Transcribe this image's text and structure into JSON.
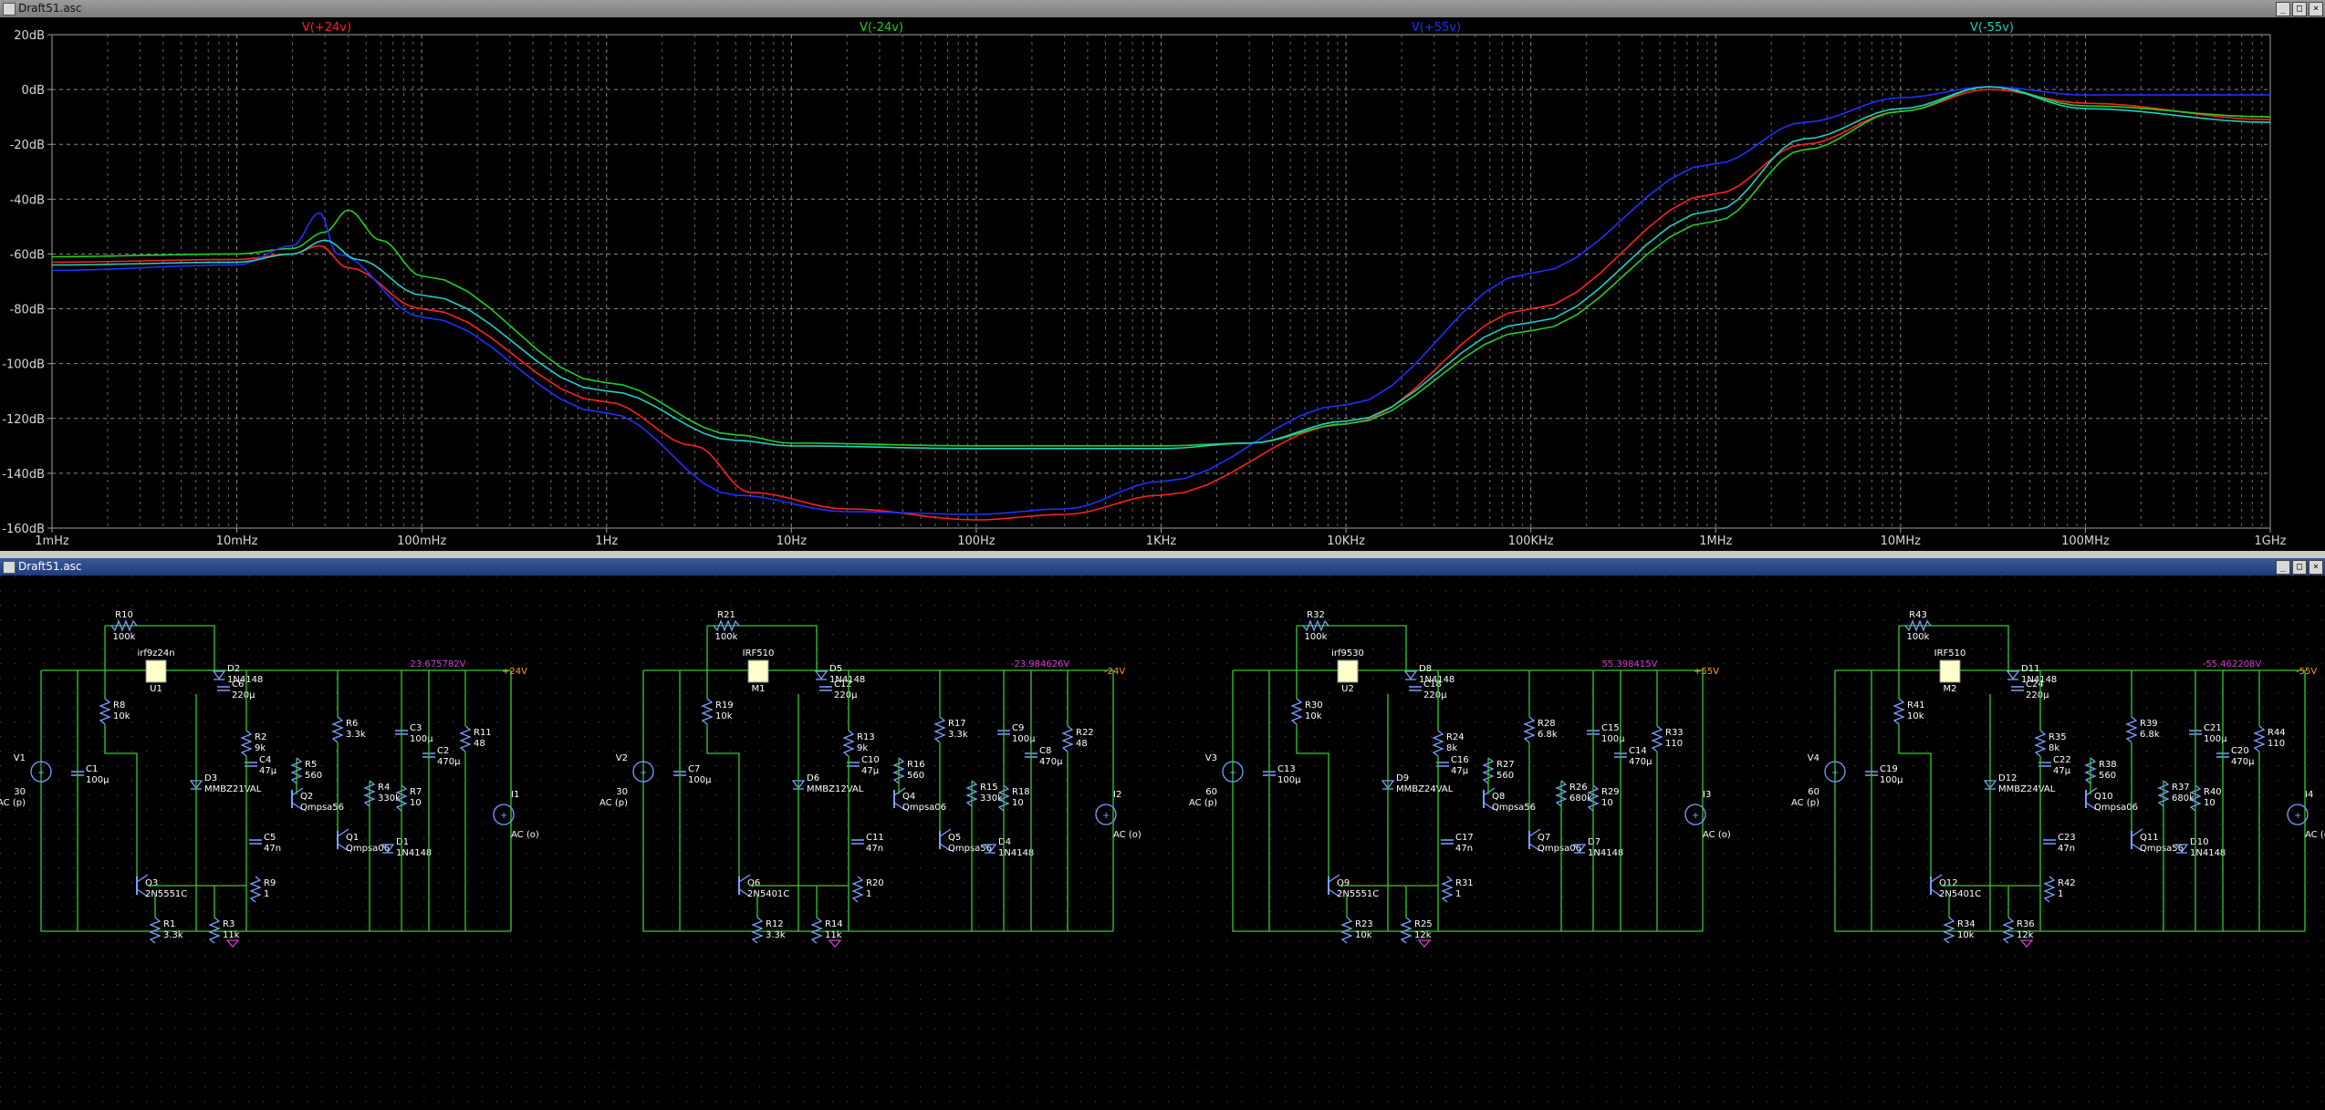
{
  "plot_window": {
    "title": "Draft51.asc",
    "buttons": [
      "_",
      "□",
      "×"
    ]
  },
  "schematic_window": {
    "title": "Draft51.asc",
    "buttons": [
      "_",
      "□",
      "×"
    ]
  },
  "chart_data": {
    "type": "line",
    "title": "",
    "xlabel": "",
    "ylabel": "",
    "x_scale": "log",
    "xlim_hz": [
      0.001,
      1000000000
    ],
    "ylim_db": [
      -160,
      20
    ],
    "grid": true,
    "x_tick_labels": [
      "1mHz",
      "10mHz",
      "100mHz",
      "1Hz",
      "10Hz",
      "100Hz",
      "1KHz",
      "10KHz",
      "100KHz",
      "1MHz",
      "10MHz",
      "100MHz",
      "1GHz"
    ],
    "y_tick_labels": [
      "20dB",
      "0dB",
      "-20dB",
      "-40dB",
      "-60dB",
      "-80dB",
      "-100dB",
      "-120dB",
      "-140dB",
      "-160dB"
    ],
    "y_tick_values": [
      20,
      0,
      -20,
      -40,
      -60,
      -80,
      -100,
      -120,
      -140,
      -160
    ],
    "series": [
      {
        "name": "V(+24v)",
        "color": "#ff2020",
        "points": [
          [
            0.001,
            -63
          ],
          [
            0.01,
            -62
          ],
          [
            0.02,
            -60
          ],
          [
            0.028,
            -57
          ],
          [
            0.04,
            -65
          ],
          [
            0.1,
            -80
          ],
          [
            1,
            -114
          ],
          [
            3,
            -130
          ],
          [
            6,
            -147
          ],
          [
            20,
            -153
          ],
          [
            100,
            -157
          ],
          [
            300,
            -155
          ],
          [
            1000,
            -148
          ],
          [
            10000,
            -122
          ],
          [
            100000,
            -80
          ],
          [
            1000000,
            -38
          ],
          [
            3000000,
            -20
          ],
          [
            10000000,
            -8
          ],
          [
            30000000,
            0
          ],
          [
            100000000,
            -5
          ],
          [
            1000000000,
            -11
          ]
        ]
      },
      {
        "name": "V(-24v)",
        "color": "#20d020",
        "points": [
          [
            0.001,
            -61
          ],
          [
            0.01,
            -60
          ],
          [
            0.02,
            -58
          ],
          [
            0.03,
            -52
          ],
          [
            0.04,
            -44
          ],
          [
            0.06,
            -55
          ],
          [
            0.1,
            -68
          ],
          [
            1,
            -107
          ],
          [
            5,
            -126
          ],
          [
            10,
            -129
          ],
          [
            100,
            -130
          ],
          [
            1000,
            -130
          ],
          [
            3000,
            -129
          ],
          [
            10000,
            -122
          ],
          [
            100000,
            -88
          ],
          [
            1000000,
            -48
          ],
          [
            3000000,
            -22
          ],
          [
            10000000,
            -8
          ],
          [
            30000000,
            1
          ],
          [
            100000000,
            -6
          ],
          [
            1000000000,
            -10
          ]
        ]
      },
      {
        "name": "V(+55v)",
        "color": "#2030ff",
        "points": [
          [
            0.001,
            -66
          ],
          [
            0.01,
            -64
          ],
          [
            0.02,
            -57
          ],
          [
            0.028,
            -45
          ],
          [
            0.035,
            -60
          ],
          [
            0.1,
            -83
          ],
          [
            1,
            -118
          ],
          [
            5,
            -148
          ],
          [
            20,
            -154
          ],
          [
            100,
            -155
          ],
          [
            300,
            -153
          ],
          [
            1000,
            -143
          ],
          [
            10000,
            -115
          ],
          [
            100000,
            -67
          ],
          [
            1000000,
            -27
          ],
          [
            3000000,
            -12
          ],
          [
            10000000,
            -3
          ],
          [
            30000000,
            1
          ],
          [
            100000000,
            -2
          ],
          [
            1000000000,
            -2
          ]
        ]
      },
      {
        "name": "V(-55v)",
        "color": "#20d0c0",
        "points": [
          [
            0.001,
            -64
          ],
          [
            0.01,
            -63
          ],
          [
            0.02,
            -60
          ],
          [
            0.03,
            -55
          ],
          [
            0.045,
            -62
          ],
          [
            0.1,
            -75
          ],
          [
            1,
            -110
          ],
          [
            5,
            -128
          ],
          [
            10,
            -130
          ],
          [
            100,
            -131
          ],
          [
            1000,
            -131
          ],
          [
            3000,
            -129
          ],
          [
            10000,
            -121
          ],
          [
            100000,
            -85
          ],
          [
            1000000,
            -44
          ],
          [
            3000000,
            -18
          ],
          [
            10000000,
            -7
          ],
          [
            30000000,
            1
          ],
          [
            100000000,
            -7
          ],
          [
            1000000000,
            -12
          ]
        ]
      }
    ]
  },
  "schematic": {
    "circuits": [
      {
        "id": "c1",
        "feedback_resistor": {
          "ref": "R10",
          "value": "100k"
        },
        "device": {
          "ref": "U1",
          "value": "irf9z24n"
        },
        "out_voltage": "23.675782V",
        "rail_label": "+24V",
        "source": {
          "ref": "V1",
          "value": "30",
          "ac": "AC (p)"
        },
        "load": {
          "ref": "I1",
          "ac": "AC (o)"
        },
        "parts": [
          {
            "ref": "R8",
            "value": "10k"
          },
          {
            "ref": "C1",
            "value": "100µ"
          },
          {
            "ref": "D2",
            "value": "1N4148"
          },
          {
            "ref": "C6",
            "value": "220µ"
          },
          {
            "ref": "R2",
            "value": "9k"
          },
          {
            "ref": "D3",
            "value": "MMBZ21VAL"
          },
          {
            "ref": "C4",
            "value": "47µ"
          },
          {
            "ref": "R5",
            "value": "560"
          },
          {
            "ref": "R6",
            "value": "3.3k"
          },
          {
            "ref": "Q2",
            "value": "Qmpsa56"
          },
          {
            "ref": "R4",
            "value": "330k"
          },
          {
            "ref": "C3",
            "value": "100µ"
          },
          {
            "ref": "C2",
            "value": "470µ"
          },
          {
            "ref": "R11",
            "value": "48"
          },
          {
            "ref": "R7",
            "value": "10"
          },
          {
            "ref": "Q1",
            "value": "Qmpsa06"
          },
          {
            "ref": "D1",
            "value": "1N4148"
          },
          {
            "ref": "C5",
            "value": "47n"
          },
          {
            "ref": "R9",
            "value": "1"
          },
          {
            "ref": "Q3",
            "value": "2N5551C"
          },
          {
            "ref": "R1",
            "value": "3.3k"
          },
          {
            "ref": "R3",
            "value": "11k"
          }
        ]
      },
      {
        "id": "c2",
        "feedback_resistor": {
          "ref": "R21",
          "value": "100k"
        },
        "device": {
          "ref": "M1",
          "value": "IRF510"
        },
        "out_voltage": "-23.984626V",
        "rail_label": "-24V",
        "source": {
          "ref": "V2",
          "value": "30",
          "ac": "AC (p)"
        },
        "load": {
          "ref": "I2",
          "ac": "AC (o)"
        },
        "parts": [
          {
            "ref": "R19",
            "value": "10k"
          },
          {
            "ref": "C7",
            "value": "100µ"
          },
          {
            "ref": "D5",
            "value": "1N4148"
          },
          {
            "ref": "C12",
            "value": "220µ"
          },
          {
            "ref": "R13",
            "value": "9k"
          },
          {
            "ref": "D6",
            "value": "MMBZ12VAL"
          },
          {
            "ref": "C10",
            "value": "47µ"
          },
          {
            "ref": "R16",
            "value": "560"
          },
          {
            "ref": "R17",
            "value": "3.3k"
          },
          {
            "ref": "Q4",
            "value": "Qmpsa06"
          },
          {
            "ref": "R15",
            "value": "330k"
          },
          {
            "ref": "C9",
            "value": "100µ"
          },
          {
            "ref": "C8",
            "value": "470µ"
          },
          {
            "ref": "R22",
            "value": "48"
          },
          {
            "ref": "R18",
            "value": "10"
          },
          {
            "ref": "Q5",
            "value": "Qmpsa56"
          },
          {
            "ref": "D4",
            "value": "1N4148"
          },
          {
            "ref": "C11",
            "value": "47n"
          },
          {
            "ref": "R20",
            "value": "1"
          },
          {
            "ref": "Q6",
            "value": "2N5401C"
          },
          {
            "ref": "R12",
            "value": "3.3k"
          },
          {
            "ref": "R14",
            "value": "11k"
          }
        ]
      },
      {
        "id": "c3",
        "feedback_resistor": {
          "ref": "R32",
          "value": "100k"
        },
        "device": {
          "ref": "U2",
          "value": "irf9530"
        },
        "out_voltage": "55.398415V",
        "rail_label": "+55V",
        "source": {
          "ref": "V3",
          "value": "60",
          "ac": "AC (p)"
        },
        "load": {
          "ref": "I3",
          "ac": "AC (o)"
        },
        "parts": [
          {
            "ref": "R30",
            "value": "10k"
          },
          {
            "ref": "C13",
            "value": "100µ"
          },
          {
            "ref": "D8",
            "value": "1N4148"
          },
          {
            "ref": "C18",
            "value": "220µ"
          },
          {
            "ref": "R24",
            "value": "8k"
          },
          {
            "ref": "D9",
            "value": "MMBZ24VAL"
          },
          {
            "ref": "C16",
            "value": "47µ"
          },
          {
            "ref": "R27",
            "value": "560"
          },
          {
            "ref": "R28",
            "value": "6.8k"
          },
          {
            "ref": "Q8",
            "value": "Qmpsa56"
          },
          {
            "ref": "R26",
            "value": "680k"
          },
          {
            "ref": "C15",
            "value": "100µ"
          },
          {
            "ref": "C14",
            "value": "470µ"
          },
          {
            "ref": "R33",
            "value": "110"
          },
          {
            "ref": "R29",
            "value": "10"
          },
          {
            "ref": "Q7",
            "value": "Qmpsa06"
          },
          {
            "ref": "D7",
            "value": "1N4148"
          },
          {
            "ref": "C17",
            "value": "47n"
          },
          {
            "ref": "R31",
            "value": "1"
          },
          {
            "ref": "Q9",
            "value": "2N5551C"
          },
          {
            "ref": "R23",
            "value": "10k"
          },
          {
            "ref": "R25",
            "value": "12k"
          }
        ]
      },
      {
        "id": "c4",
        "feedback_resistor": {
          "ref": "R43",
          "value": "100k"
        },
        "device": {
          "ref": "M2",
          "value": "IRF510"
        },
        "out_voltage": "-55.462208V",
        "rail_label": "-55V",
        "source": {
          "ref": "V4",
          "value": "60",
          "ac": "AC (p)"
        },
        "load": {
          "ref": "I4",
          "ac": "AC (o)"
        },
        "parts": [
          {
            "ref": "R41",
            "value": "10k"
          },
          {
            "ref": "C19",
            "value": "100µ"
          },
          {
            "ref": "D11",
            "value": "1N4148"
          },
          {
            "ref": "C24",
            "value": "220µ"
          },
          {
            "ref": "R35",
            "value": "8k"
          },
          {
            "ref": "D12",
            "value": "MMBZ24VAL"
          },
          {
            "ref": "C22",
            "value": "47µ"
          },
          {
            "ref": "R38",
            "value": "560"
          },
          {
            "ref": "R39",
            "value": "6.8k"
          },
          {
            "ref": "Q10",
            "value": "Qmpsa06"
          },
          {
            "ref": "R37",
            "value": "680k"
          },
          {
            "ref": "C21",
            "value": "100µ"
          },
          {
            "ref": "C20",
            "value": "470µ"
          },
          {
            "ref": "R44",
            "value": "110"
          },
          {
            "ref": "R40",
            "value": "10"
          },
          {
            "ref": "Q11",
            "value": "Qmpsa56"
          },
          {
            "ref": "D10",
            "value": "1N4148"
          },
          {
            "ref": "C23",
            "value": "47n"
          },
          {
            "ref": "R42",
            "value": "1"
          },
          {
            "ref": "Q12",
            "value": "2N5401C"
          },
          {
            "ref": "R34",
            "value": "10k"
          },
          {
            "ref": "R36",
            "value": "12k"
          }
        ]
      }
    ]
  }
}
